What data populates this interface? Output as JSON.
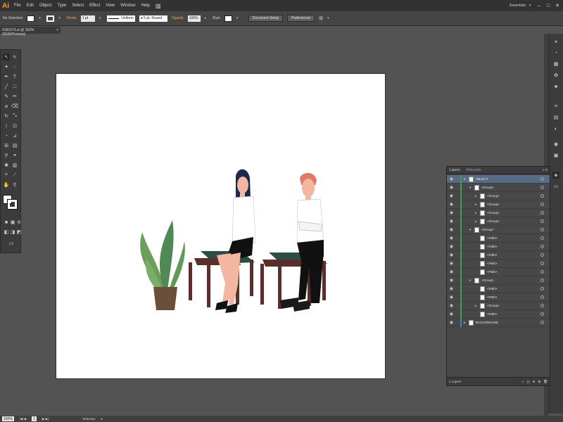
{
  "app": {
    "logo": "Ai"
  },
  "menu": [
    "File",
    "Edit",
    "Object",
    "Type",
    "Select",
    "Effect",
    "View",
    "Window",
    "Help"
  ],
  "workspace": "Essentials",
  "window_controls": [
    "–",
    "□",
    "✕"
  ],
  "control": {
    "selection": "No Selection",
    "stroke_label": "Stroke",
    "stroke_value": "1 pt",
    "profile": "Uniform",
    "brush": "5 pt. Round",
    "opacity_label": "Opacity",
    "opacity_value": "100%",
    "style_label": "Style",
    "doc_setup": "Document Setup",
    "preferences": "Preferences"
  },
  "doc_tab": {
    "title": "4181673.ai @ 150% (RGB/Preview)",
    "close": "×"
  },
  "layers": {
    "tab_active": "Layers",
    "tab_inactive": "Artboards",
    "rows": [
      {
        "label": "OBJECT"
      },
      {
        "label": "<Group>"
      },
      {
        "label": "<Group>"
      },
      {
        "label": "<Group>"
      },
      {
        "label": "<Group>"
      },
      {
        "label": "<Group>"
      },
      {
        "label": "<Group>"
      },
      {
        "label": "<Path>"
      },
      {
        "label": "<Path>"
      },
      {
        "label": "<Path>"
      },
      {
        "label": "<Path>"
      },
      {
        "label": "<Path>"
      },
      {
        "label": "<Group>"
      },
      {
        "label": "<Path>"
      },
      {
        "label": "<Path>"
      },
      {
        "label": "<Group>"
      },
      {
        "label": "<Path>"
      },
      {
        "label": "BACKGROUND"
      }
    ],
    "count": "2 Layers"
  },
  "status": {
    "zoom": "150%",
    "page": "1",
    "tool": "Selection"
  },
  "colors": {
    "chrome": "#535353",
    "menubar": "#323232",
    "accent_orange": "#ff9a00",
    "layer_green": "#33a352",
    "layer_blue": "#4a78d4",
    "selected_row": "#576a86"
  }
}
